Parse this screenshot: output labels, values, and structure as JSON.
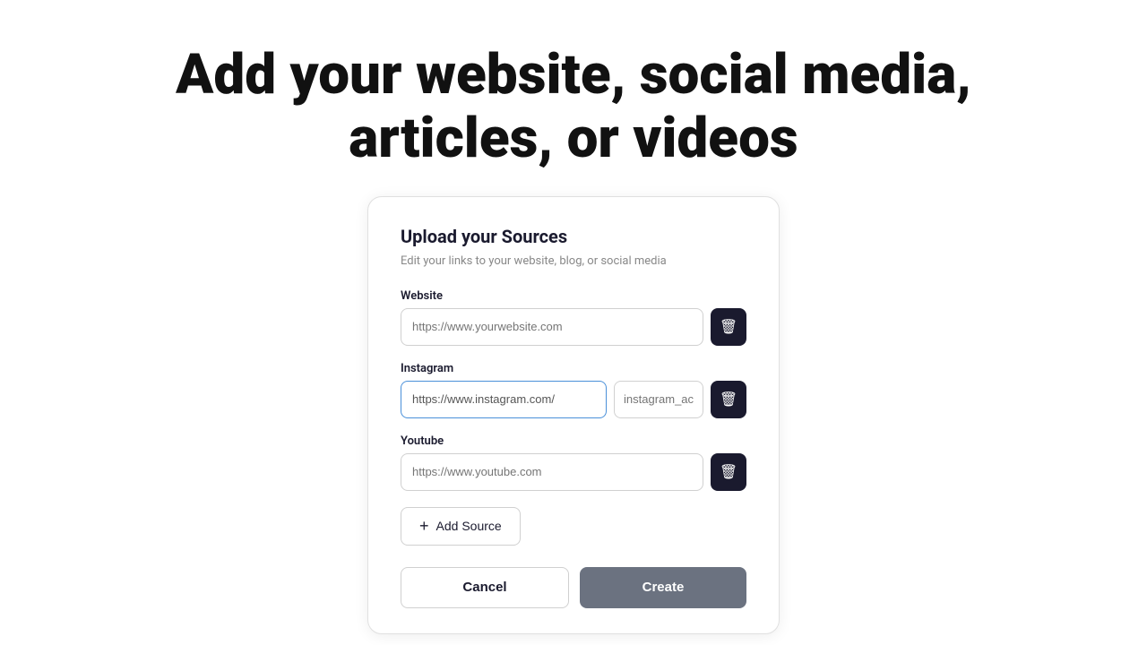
{
  "page": {
    "title_line1": "Add your website, social media,",
    "title_line2": "articles, or videos"
  },
  "card": {
    "title": "Upload your Sources",
    "subtitle": "Edit your links to your website, blog, or social media",
    "fields": [
      {
        "label": "Website",
        "placeholder": "https://www.yourwebsite.com",
        "value": "",
        "secondary_placeholder": null,
        "active": false
      },
      {
        "label": "Instagram",
        "placeholder": "https://www.instagram.com/",
        "value": "https://www.instagram.com/",
        "secondary_placeholder": "instagram_acco",
        "active": true
      },
      {
        "label": "Youtube",
        "placeholder": "https://www.youtube.com",
        "value": "",
        "secondary_placeholder": null,
        "active": false
      }
    ],
    "add_source_label": "Add Source",
    "cancel_label": "Cancel",
    "create_label": "Create"
  },
  "icons": {
    "trash": "🗑",
    "plus": "+"
  }
}
